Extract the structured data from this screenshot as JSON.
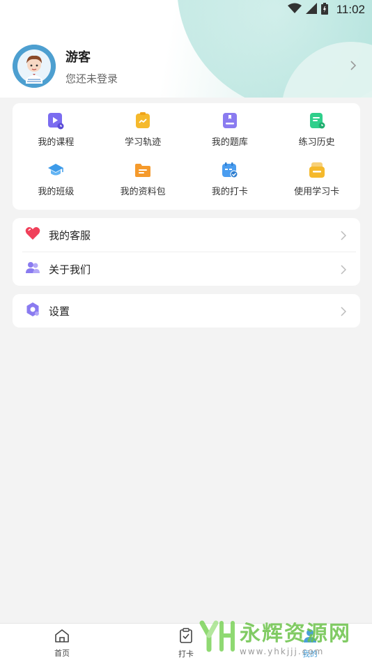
{
  "status_bar": {
    "time": "11:02",
    "icons": [
      "wifi-icon",
      "signal-icon",
      "battery-icon"
    ]
  },
  "profile": {
    "name": "游客",
    "subtitle": "您还未登录"
  },
  "shortcuts": [
    {
      "label": "我的课程",
      "icon": "course-play-icon",
      "color": "#7b6cf0"
    },
    {
      "label": "学习轨迹",
      "icon": "learning-track-icon",
      "color": "#f5b92c"
    },
    {
      "label": "我的题库",
      "icon": "question-bank-icon",
      "color": "#8a7bf0"
    },
    {
      "label": "练习历史",
      "icon": "practice-history-icon",
      "color": "#2fcf8b"
    },
    {
      "label": "我的班级",
      "icon": "class-cap-icon",
      "color": "#3d9be9"
    },
    {
      "label": "我的资料包",
      "icon": "folder-icon",
      "color": "#f59a2c"
    },
    {
      "label": "我的打卡",
      "icon": "checkin-calendar-icon",
      "color": "#4a9df0"
    },
    {
      "label": "使用学习卡",
      "icon": "study-card-icon",
      "color": "#f5b92c"
    }
  ],
  "menu": {
    "service": "我的客服",
    "about": "关于我们",
    "settings": "设置"
  },
  "tabbar": {
    "home": "首页",
    "checkin": "打卡",
    "mine": "我的"
  },
  "watermark": {
    "name": "永辉资源网",
    "url": "www.yhkjjj.com"
  }
}
